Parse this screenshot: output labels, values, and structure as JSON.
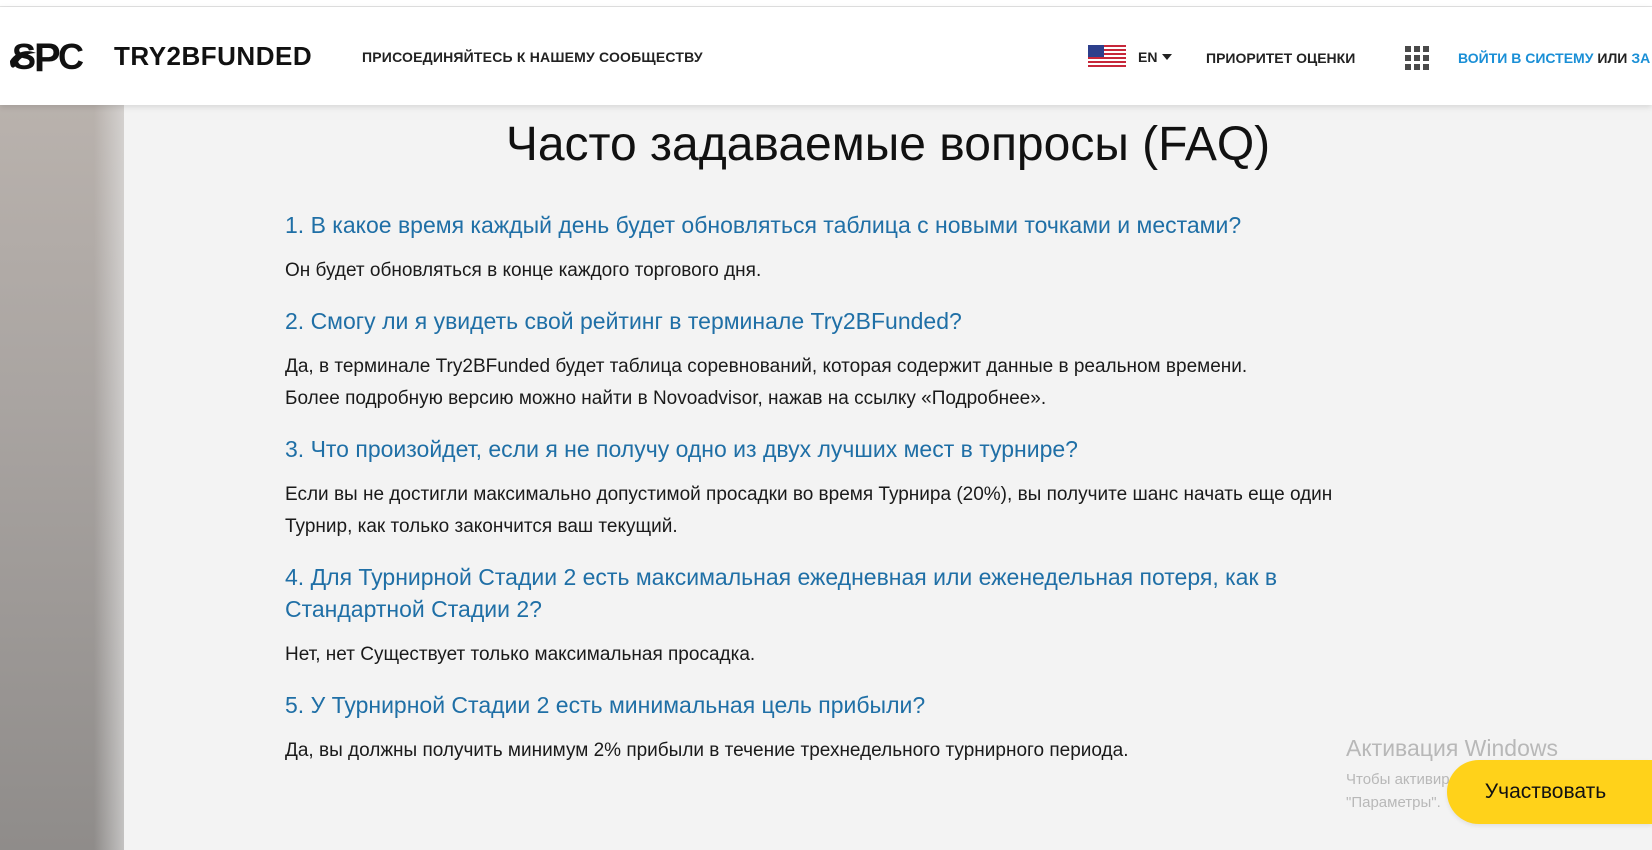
{
  "header": {
    "brand": "TRY2BFUNDED",
    "join_link": "ПРИСОЕДИНЯЙТЕСЬ К НАШЕМУ СООБЩЕСТВУ",
    "language": "EN",
    "priority_link": "ПРИОРИТЕТ ОЦЕНКИ",
    "login_link": "ВОЙТИ В СИСТЕМУ",
    "or_text": "ИЛИ",
    "register_link_partial": "ЗА"
  },
  "faq": {
    "title": "Часто задаваемые вопросы (FAQ)",
    "items": [
      {
        "question": "1. В какое время каждый день будет обновляться таблица с новыми точками и местами?",
        "answer": "Он будет обновляться в конце каждого торгового дня."
      },
      {
        "question": "2. Смогу ли я увидеть свой рейтинг в терминале Try2BFunded?",
        "answer": "Да, в терминале Try2BFunded будет таблица соревнований, которая содержит данные в реальном времени.\nБолее подробную версию можно найти в Novoadvisor, нажав на ссылку «Подробнее»."
      },
      {
        "question": "3. Что произойдет, если я не получу одно из двух лучших мест в турнире?",
        "answer": "Если вы не достигли максимально допустимой просадки во время Турнира (20%), вы получите шанс начать еще один\nТурнир, как только закончится ваш текущий."
      },
      {
        "question": "4. Для Турнирной Стадии 2 есть максимальная ежедневная или еженедельная потеря, как в\nСтандартной Стадии 2?",
        "answer": "Нет, нет Существует только максимальная просадка."
      },
      {
        "question": "5. У Турнирной Стадии 2 есть минимальная цель прибыли?",
        "answer": "Да, вы должны получить минимум 2% прибыли в течение трехнедельного турнирного периода."
      }
    ]
  },
  "windows_watermark": {
    "title": "Активация Windows",
    "line1": "Чтобы активировать Windows, перей",
    "line2": "\"Параметры\"."
  },
  "cta": {
    "participate": "Участвовать"
  },
  "colors": {
    "question_blue": "#1f6fa6",
    "link_blue": "#1a8fd6",
    "cta_yellow": "#ffd21a",
    "content_bg": "#f3f3f3"
  },
  "icons": [
    "spc-logo-icon",
    "us-flag-icon",
    "caret-down-icon",
    "apps-grid-icon"
  ]
}
